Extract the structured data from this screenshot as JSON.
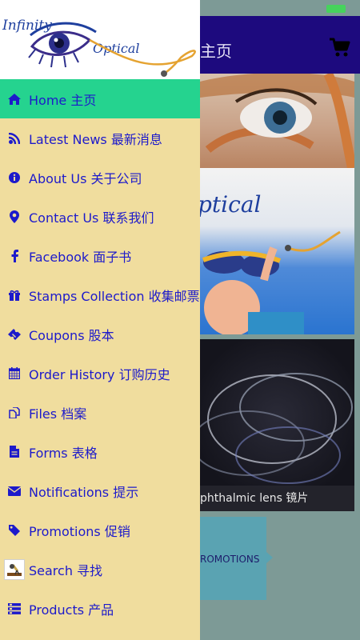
{
  "header": {
    "title": "主页"
  },
  "status_bar": {
    "battery_color": "#46d35c"
  },
  "logo": {
    "line1": "Infinity",
    "line2": "Optical"
  },
  "background": {
    "banner_text": "ptical",
    "lens_caption": "phthalmic lens 镜片",
    "promo_label": "ROMOTIONS"
  },
  "menu": {
    "items": [
      {
        "label": "Home 主页",
        "icon": "home-icon"
      },
      {
        "label": "Latest News 最新消息",
        "icon": "rss-icon"
      },
      {
        "label": "About Us 关于公司",
        "icon": "info-icon"
      },
      {
        "label": "Contact Us 联系我们",
        "icon": "location-pin-icon"
      },
      {
        "label": "Facebook 面子书",
        "icon": "facebook-icon"
      },
      {
        "label": "Stamps Collection 收集邮票",
        "icon": "gift-icon"
      },
      {
        "label": "Coupons 股本",
        "icon": "ticket-icon"
      },
      {
        "label": "Order History 订购历史",
        "icon": "calendar-icon"
      },
      {
        "label": "Files 档案",
        "icon": "files-icon"
      },
      {
        "label": "Forms 表格",
        "icon": "document-icon"
      },
      {
        "label": "Notifications 提示",
        "icon": "envelope-icon"
      },
      {
        "label": "Promotions 促销",
        "icon": "tag-icon"
      },
      {
        "label": "Search 寻找",
        "icon": "search-thumbnail-icon"
      },
      {
        "label": "Products 产品",
        "icon": "products-list-icon"
      }
    ]
  },
  "colors": {
    "drawer_bg": "#f0dd9e",
    "active_item_bg": "#25d38f",
    "menu_text": "#1d1acb",
    "header_bg": "#1d0a7e"
  }
}
